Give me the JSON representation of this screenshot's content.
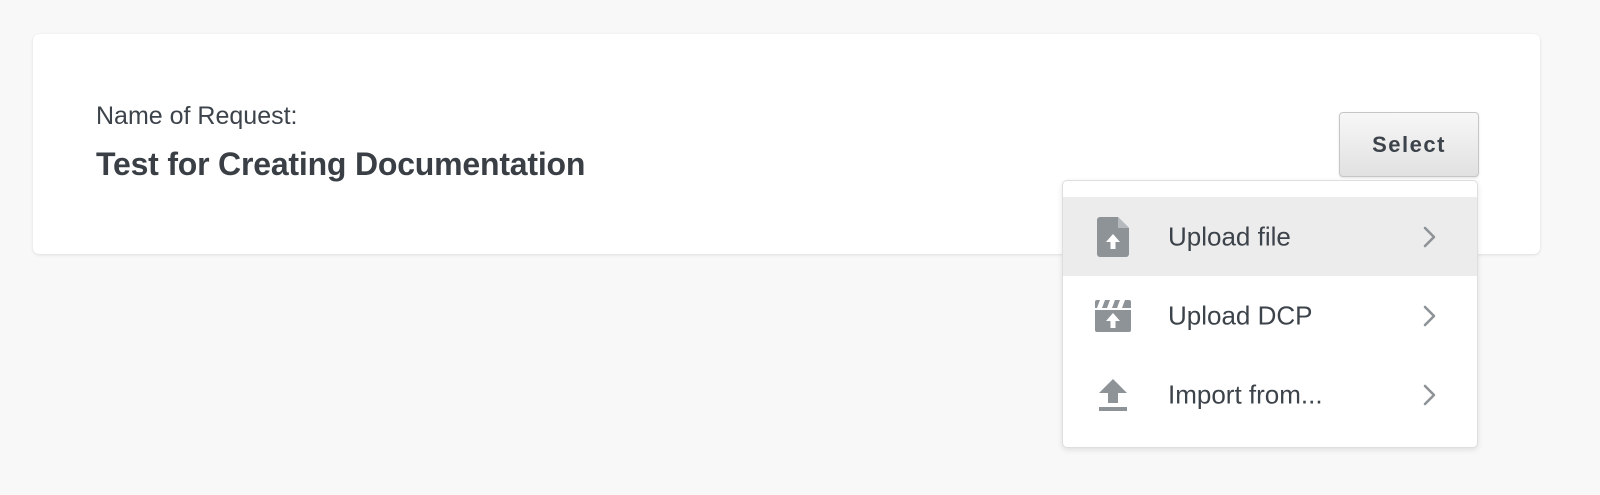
{
  "request": {
    "label": "Name of Request:",
    "name": "Test for Creating Documentation"
  },
  "select_button": {
    "label": "Select"
  },
  "dropdown": {
    "items": [
      {
        "label": "Upload file",
        "icon": "file-upload-icon",
        "highlighted": true
      },
      {
        "label": "Upload DCP",
        "icon": "clapperboard-upload-icon",
        "highlighted": false
      },
      {
        "label": "Import from...",
        "icon": "upload-arrow-icon",
        "highlighted": false
      }
    ]
  },
  "colors": {
    "background": "#f8f8f8",
    "card": "#ffffff",
    "text": "#3d434a",
    "icon": "#8e9398",
    "highlight": "#ececec"
  }
}
